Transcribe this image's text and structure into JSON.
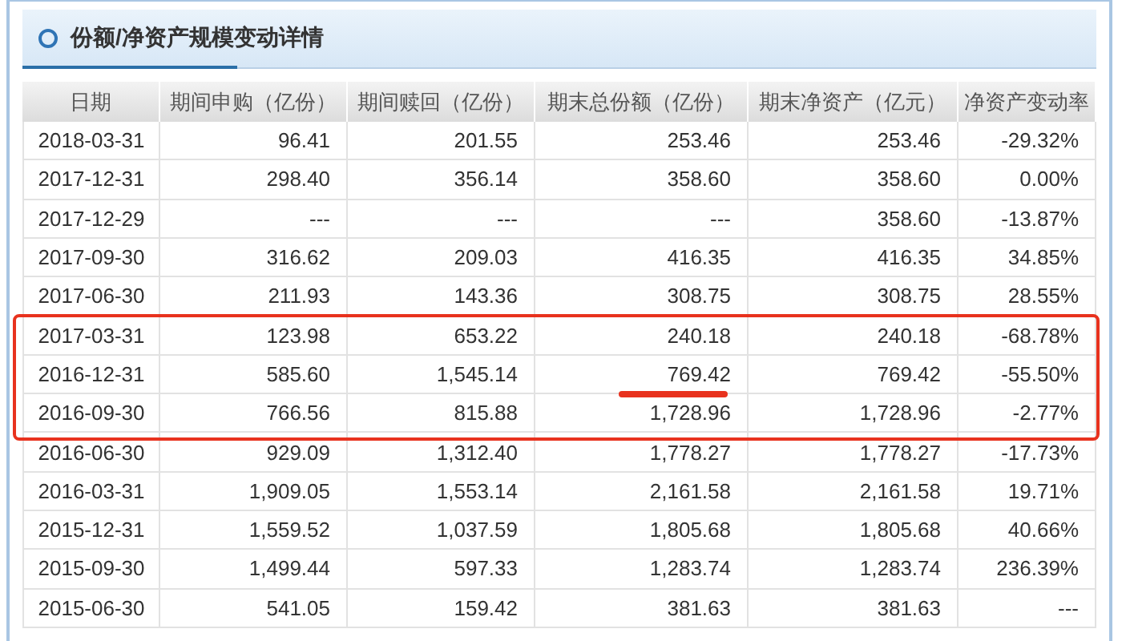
{
  "panel": {
    "title": "份额/净资产规模变动详情"
  },
  "table": {
    "columns": [
      "日期",
      "期间申购（亿份）",
      "期间赎回（亿份）",
      "期末总份额（亿份）",
      "期末净资产（亿元）",
      "净资产变动率"
    ],
    "rows": [
      {
        "cells": [
          "2018-03-31",
          "96.41",
          "201.55",
          "253.46",
          "253.46",
          "-29.32%"
        ],
        "boxed": false,
        "total_underlined": false
      },
      {
        "cells": [
          "2017-12-31",
          "298.40",
          "356.14",
          "358.60",
          "358.60",
          "0.00%"
        ],
        "boxed": false,
        "total_underlined": false
      },
      {
        "cells": [
          "2017-12-29",
          "---",
          "---",
          "---",
          "358.60",
          "-13.87%"
        ],
        "boxed": false,
        "total_underlined": false
      },
      {
        "cells": [
          "2017-09-30",
          "316.62",
          "209.03",
          "416.35",
          "416.35",
          "34.85%"
        ],
        "boxed": false,
        "total_underlined": false
      },
      {
        "cells": [
          "2017-06-30",
          "211.93",
          "143.36",
          "308.75",
          "308.75",
          "28.55%"
        ],
        "boxed": false,
        "total_underlined": false
      },
      {
        "cells": [
          "2017-03-31",
          "123.98",
          "653.22",
          "240.18",
          "240.18",
          "-68.78%"
        ],
        "boxed": true,
        "total_underlined": false
      },
      {
        "cells": [
          "2016-12-31",
          "585.60",
          "1,545.14",
          "769.42",
          "769.42",
          "-55.50%"
        ],
        "boxed": true,
        "total_underlined": true
      },
      {
        "cells": [
          "2016-09-30",
          "766.56",
          "815.88",
          "1,728.96",
          "1,728.96",
          "-2.77%"
        ],
        "boxed": true,
        "total_underlined": false
      },
      {
        "cells": [
          "2016-06-30",
          "929.09",
          "1,312.40",
          "1,778.27",
          "1,778.27",
          "-17.73%"
        ],
        "boxed": false,
        "total_underlined": false
      },
      {
        "cells": [
          "2016-03-31",
          "1,909.05",
          "1,553.14",
          "2,161.58",
          "2,161.58",
          "19.71%"
        ],
        "boxed": false,
        "total_underlined": false
      },
      {
        "cells": [
          "2015-12-31",
          "1,559.52",
          "1,037.59",
          "1,805.68",
          "1,805.68",
          "40.66%"
        ],
        "boxed": false,
        "total_underlined": false
      },
      {
        "cells": [
          "2015-09-30",
          "1,499.44",
          "597.33",
          "1,283.74",
          "1,283.74",
          "236.39%"
        ],
        "boxed": false,
        "total_underlined": false
      },
      {
        "cells": [
          "2015-06-30",
          "541.05",
          "159.42",
          "381.63",
          "381.63",
          "---"
        ],
        "boxed": false,
        "total_underlined": false
      }
    ]
  }
}
